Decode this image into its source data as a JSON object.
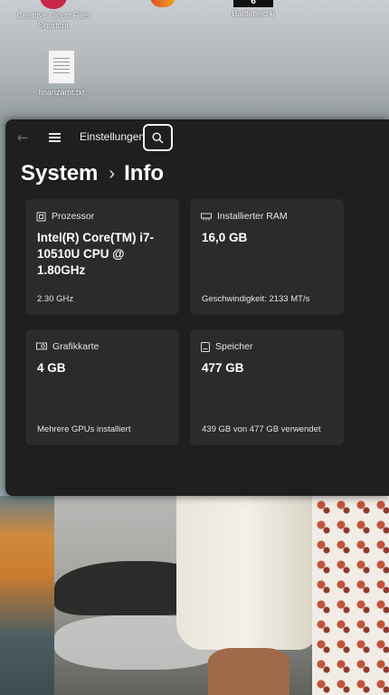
{
  "desktop": {
    "icons": [
      {
        "label_line1": "Creative Cloud Files",
        "label_line2": "Shortcut"
      },
      {
        "label_line1": "",
        "label_line2": ""
      },
      {
        "label_line1": "Battlefield 6",
        "label_line2": ""
      },
      {
        "label_line1": "finanzamt.txt",
        "label_line2": ""
      }
    ]
  },
  "window": {
    "app_title": "Einstellungen",
    "back_icon": "back-arrow-icon",
    "menu_icon": "hamburger-icon",
    "search_icon": "search-icon"
  },
  "breadcrumb": {
    "root": "System",
    "separator": "›",
    "current": "Info"
  },
  "cards": [
    {
      "title": "Prozessor",
      "icon": "processor-icon",
      "value": "Intel(R) Core(TM) i7-10510U CPU @ 1.80GHz",
      "sub": "2.30 GHz"
    },
    {
      "title": "Installierter RAM",
      "icon": "ram-icon",
      "value": "16,0 GB",
      "sub": "Geschwindigkeit: 2133 MT/s"
    },
    {
      "title": "Grafikkarte",
      "icon": "graphics-card-icon",
      "value": "4 GB",
      "sub": "Mehrere GPUs installiert"
    },
    {
      "title": "Speicher",
      "icon": "storage-icon",
      "value": "477 GB",
      "sub": "439 GB von 477 GB verwendet"
    }
  ],
  "colors": {
    "window_bg": "#1f1f1f",
    "card_bg": "#2b2b2b",
    "text_primary": "#ffffff"
  }
}
